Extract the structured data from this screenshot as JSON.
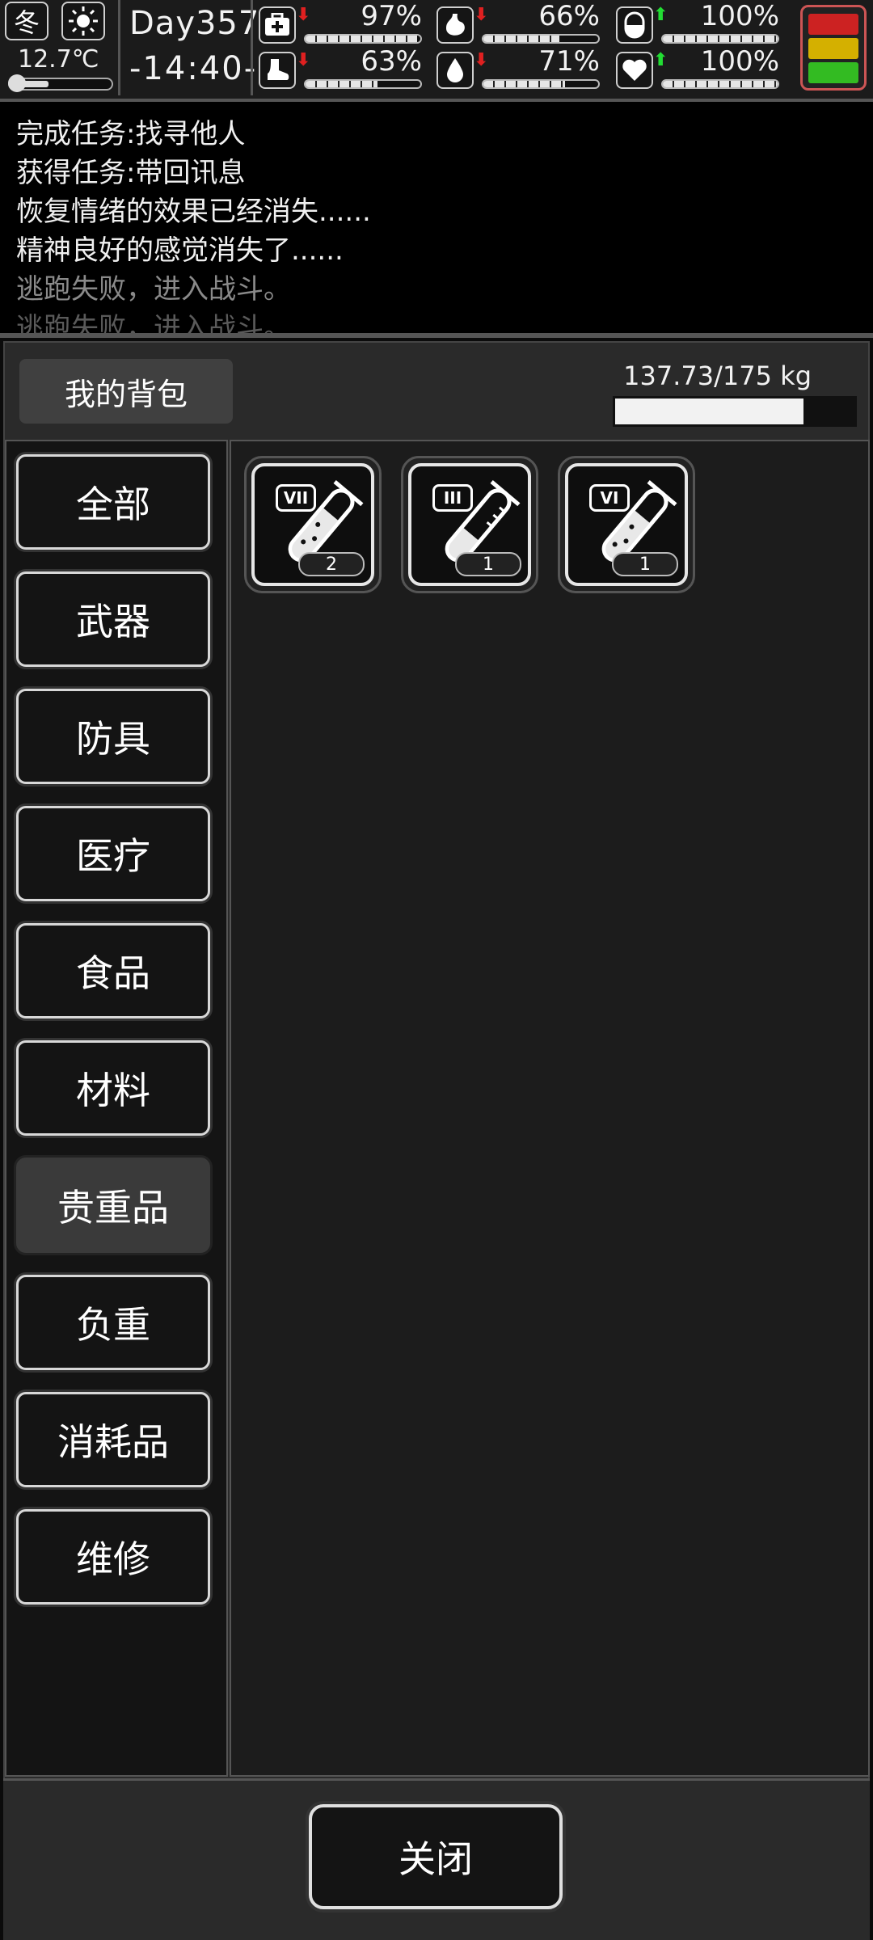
{
  "status": {
    "season_label": "冬",
    "temperature": "12.7℃",
    "day": "Day357",
    "time": "-14:40-",
    "stats": [
      {
        "name": "health",
        "value": "97%",
        "trend": "down",
        "fill": 0.97
      },
      {
        "name": "hunger",
        "value": "66%",
        "trend": "down",
        "fill": 0.66
      },
      {
        "name": "mood",
        "value": "100%",
        "trend": "up",
        "fill": 1.0
      },
      {
        "name": "stamina",
        "value": "63%",
        "trend": "down",
        "fill": 0.63
      },
      {
        "name": "thirst",
        "value": "71%",
        "trend": "down",
        "fill": 0.71
      },
      {
        "name": "spirit",
        "value": "100%",
        "trend": "up",
        "fill": 1.0
      }
    ],
    "colors": {
      "down_arrow": "#e02020",
      "up_arrow": "#22dd33",
      "light_red": "#cc2222",
      "light_yellow": "#d4b000",
      "light_green": "#33bb22"
    }
  },
  "log": {
    "lines": [
      "完成任务:找寻他人",
      "获得任务:带回讯息",
      "恢复情绪的效果已经消失......",
      "精神良好的感觉消失了......",
      "逃跑失败，进入战斗。",
      "逃跑失败，进入战斗。"
    ]
  },
  "bag": {
    "title": "我的背包",
    "weight_text": "137.73/175 kg",
    "weight_fraction": 0.787,
    "categories": [
      {
        "label": "全部",
        "active": false
      },
      {
        "label": "武器",
        "active": false
      },
      {
        "label": "防具",
        "active": false
      },
      {
        "label": "医疗",
        "active": false
      },
      {
        "label": "食品",
        "active": false
      },
      {
        "label": "材料",
        "active": false
      },
      {
        "label": "贵重品",
        "active": true
      },
      {
        "label": "负重",
        "active": false
      },
      {
        "label": "消耗品",
        "active": false
      },
      {
        "label": "维修",
        "active": false
      }
    ],
    "items": [
      {
        "grade": "VII",
        "count": "2",
        "icon": "test-tube-icon"
      },
      {
        "grade": "III",
        "count": "1",
        "icon": "test-tube-icon"
      },
      {
        "grade": "VI",
        "count": "1",
        "icon": "test-tube-icon"
      }
    ]
  },
  "footer": {
    "close_label": "关闭"
  }
}
